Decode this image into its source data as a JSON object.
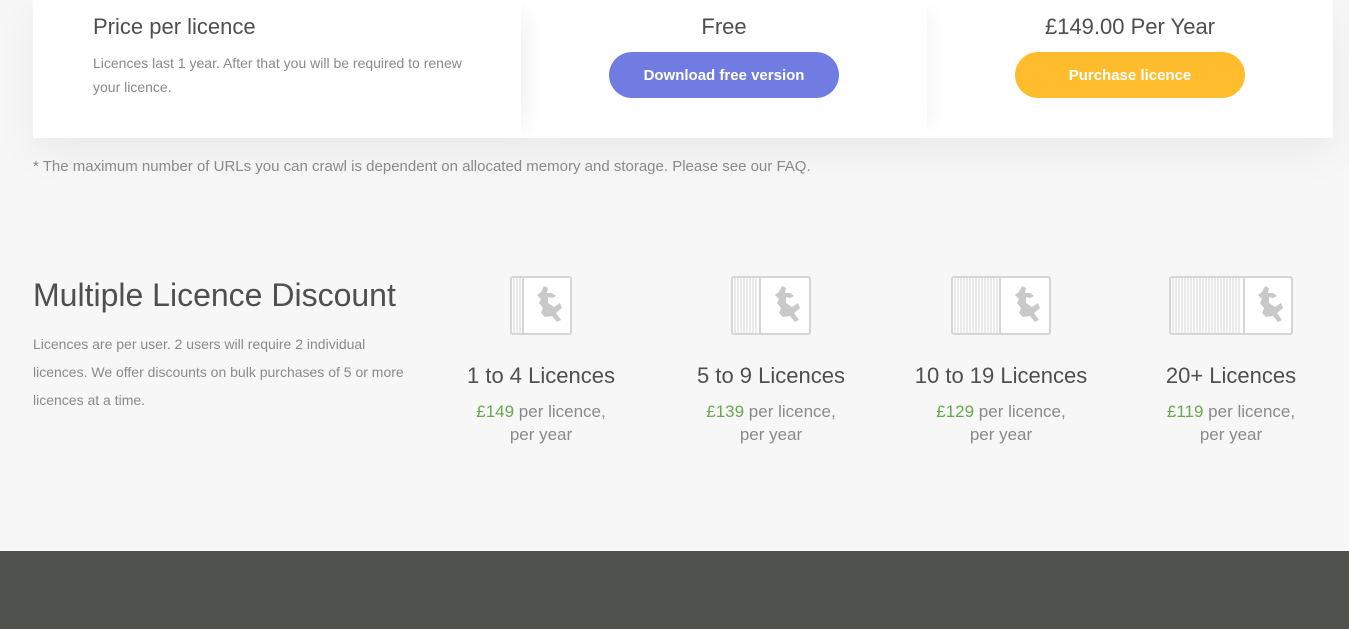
{
  "pricing": {
    "label_title": "Price per licence",
    "label_desc": "Licences last 1 year. After that you will be required to renew your licence.",
    "free_price": "Free",
    "free_button": "Download free version",
    "paid_price": "£149.00 Per Year",
    "paid_button": "Purchase licence"
  },
  "footnote": "* The maximum number of URLs you can crawl is dependent on allocated memory and storage. Please see our FAQ.",
  "discount": {
    "title": "Multiple Licence Discount",
    "description": "Licences are per user. 2 users will require 2 individual licences. We offer discounts on bulk purchases of 5 or more licences at a time.",
    "tiers": [
      {
        "name": "1 to 4 Licences",
        "price": "£149",
        "unit": " per licence,",
        "period": "per year",
        "icon": "licence-stack-icon"
      },
      {
        "name": "5 to 9 Licences",
        "price": "£139",
        "unit": " per licence,",
        "period": "per year",
        "icon": "licence-stack-icon"
      },
      {
        "name": "10 to 19 Licences",
        "price": "£129",
        "unit": " per licence,",
        "period": "per year",
        "icon": "licence-stack-icon"
      },
      {
        "name": "20+ Licences",
        "price": "£119",
        "unit": " per licence,",
        "period": "per year",
        "icon": "licence-stack-icon"
      }
    ]
  },
  "colors": {
    "free_button": "#717ce2",
    "paid_button": "#ffbd2e",
    "price_green": "#6aa84f",
    "footer": "#50524d"
  }
}
